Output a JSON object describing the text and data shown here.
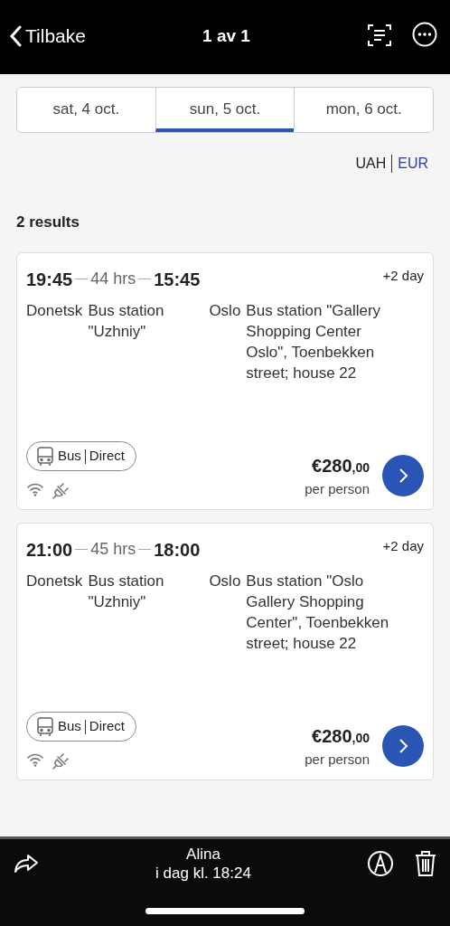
{
  "header": {
    "back_label": "Tilbake",
    "title": "1 av 1"
  },
  "date_tabs": [
    {
      "label": "sat, 4 oct.",
      "selected": false
    },
    {
      "label": "sun, 5 oct.",
      "selected": true
    },
    {
      "label": "mon, 6 oct.",
      "selected": false
    }
  ],
  "currencies": [
    {
      "label": "UAH",
      "selected": false
    },
    {
      "label": "EUR",
      "selected": true
    }
  ],
  "results_count": "2 results",
  "trips": [
    {
      "depart": "19:45",
      "duration": "44 hrs",
      "arrive": "15:45",
      "day_offset": "+2 day",
      "from_city": "Donetsk",
      "from_station": "Bus station \"Uzhniy\"",
      "to_city": "Oslo",
      "to_station": "Bus station \"Gallery Shopping Center Oslo\", Toenbekken street; house 22",
      "transport": "Bus",
      "route_type": "Direct",
      "amount": "€280",
      "cents": ",00",
      "price_note": "per person"
    },
    {
      "depart": "21:00",
      "duration": "45 hrs",
      "arrive": "18:00",
      "day_offset": "+2 day",
      "from_city": "Donetsk",
      "from_station": "Bus station \"Uzhniy\"",
      "to_city": "Oslo",
      "to_station": "Bus station \"Oslo Gallery Shopping Center\", Toenbekken street; house 22",
      "transport": "Bus",
      "route_type": "Direct",
      "amount": "€280",
      "cents": ",00",
      "price_note": "per person"
    }
  ],
  "footer": {
    "sender": "Alina",
    "time": "i dag kl. 18:24"
  }
}
